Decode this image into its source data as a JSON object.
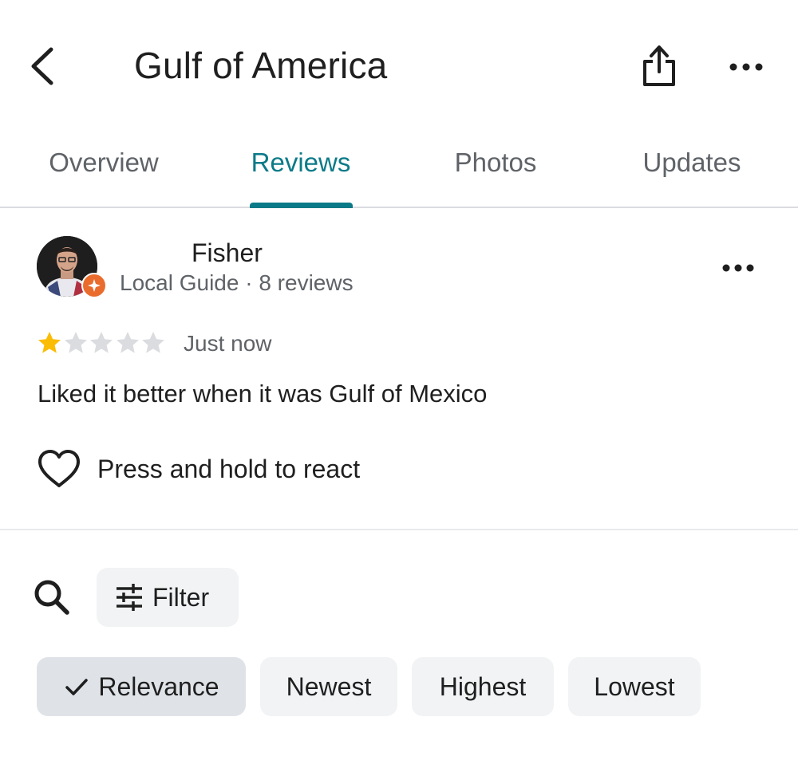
{
  "header": {
    "title": "Gulf of America",
    "back_icon": "chevron-left-icon",
    "share_icon": "share-icon",
    "more_icon": "more-horizontal-icon"
  },
  "tabs": [
    {
      "label": "Overview",
      "active": false
    },
    {
      "label": "Reviews",
      "active": true
    },
    {
      "label": "Photos",
      "active": false
    },
    {
      "label": "Updates",
      "active": false
    }
  ],
  "colors": {
    "accent": "#0b7a88",
    "star_filled": "#fbbc04",
    "star_empty": "#dadce0",
    "local_guide_badge": "#ea6c2d",
    "chip_bg": "#f1f3f4",
    "chip_selected_bg": "#dfe3e7"
  },
  "review": {
    "reviewer_name": "Fisher",
    "reviewer_meta": "Local Guide · 8 reviews",
    "rating": 1,
    "rating_max": 5,
    "time": "Just now",
    "text": "Liked it better when it was Gulf of Mexico",
    "react_label": "Press and hold to react"
  },
  "filter": {
    "label": "Filter"
  },
  "sort_chips": [
    {
      "label": "Relevance",
      "selected": true
    },
    {
      "label": "Newest",
      "selected": false
    },
    {
      "label": "Highest",
      "selected": false
    },
    {
      "label": "Lowest",
      "selected": false
    }
  ]
}
